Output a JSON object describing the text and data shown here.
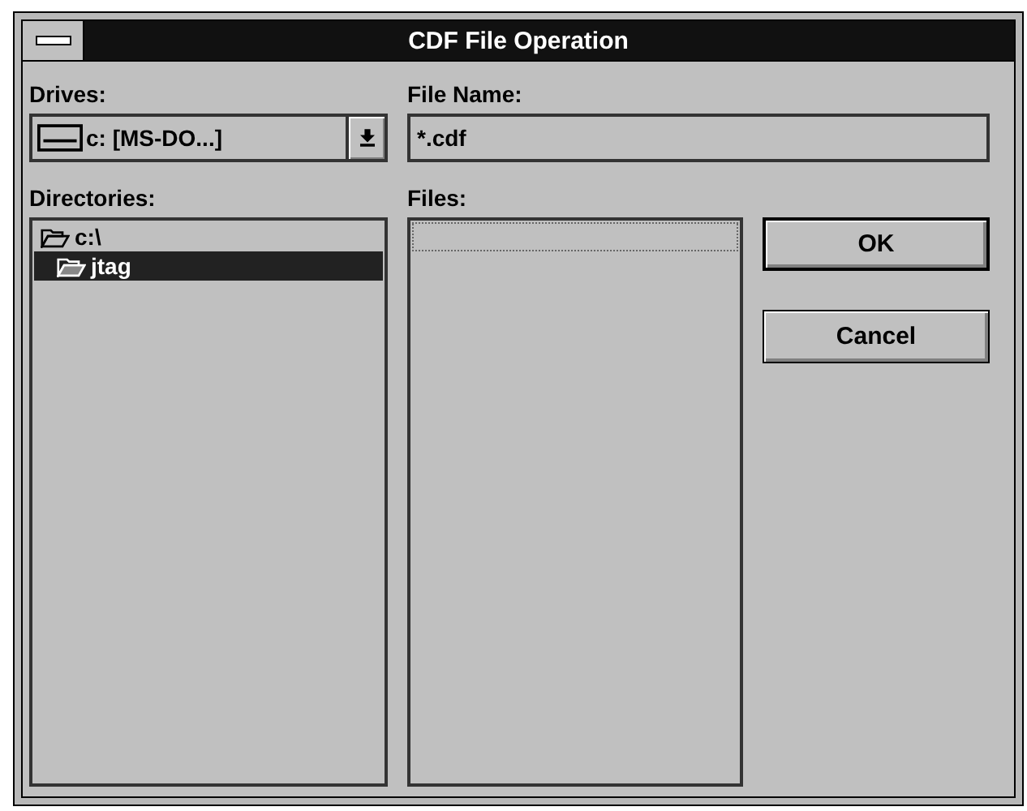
{
  "window": {
    "title": "CDF File Operation"
  },
  "drives": {
    "label": "Drives:",
    "value": "c: [MS-DO...]"
  },
  "file_name": {
    "label": "File Name:",
    "value": "*.cdf"
  },
  "directories": {
    "label": "Directories:",
    "items": [
      {
        "name": "c:\\",
        "selected": false,
        "children": [
          {
            "name": "jtag",
            "selected": true
          }
        ]
      }
    ]
  },
  "files": {
    "label": "Files:"
  },
  "buttons": [
    {
      "label": "OK",
      "default": true
    },
    {
      "label": "Cancel",
      "default": false
    }
  ]
}
